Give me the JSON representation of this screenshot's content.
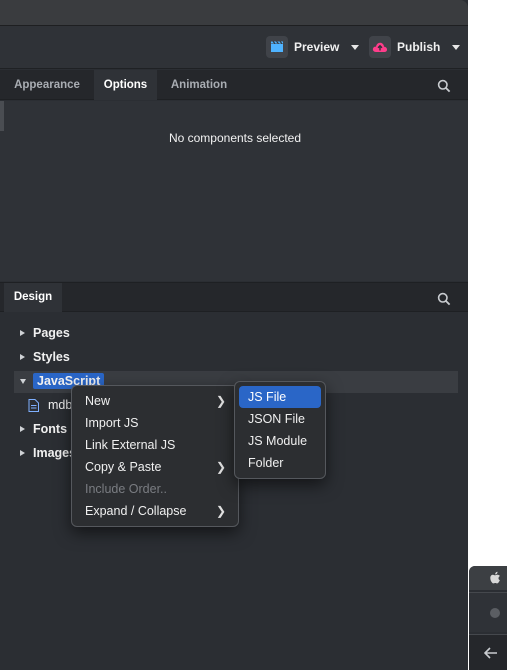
{
  "toolbar": {
    "preview_label": "Preview",
    "publish_label": "Publish"
  },
  "tabs": [
    {
      "label": "Appearance",
      "active": false
    },
    {
      "label": "Options",
      "active": true
    },
    {
      "label": "Animation",
      "active": false
    }
  ],
  "options_panel": {
    "empty_message": "No components selected"
  },
  "design": {
    "header": "Design",
    "tree": [
      {
        "label": "Pages",
        "expanded": false
      },
      {
        "label": "Styles",
        "expanded": false
      },
      {
        "label": "JavaScript",
        "expanded": true,
        "selected": true
      },
      {
        "label": "mdb",
        "type": "file"
      },
      {
        "label": "Fonts",
        "expanded": false
      },
      {
        "label": "Images",
        "expanded": false
      }
    ]
  },
  "context_menu": {
    "items": [
      {
        "label": "New",
        "submenu": true,
        "enabled": true
      },
      {
        "label": "Import JS",
        "submenu": false,
        "enabled": true
      },
      {
        "label": "Link External JS",
        "submenu": false,
        "enabled": true
      },
      {
        "label": "Copy & Paste",
        "submenu": true,
        "enabled": true
      },
      {
        "label": "Include Order..",
        "submenu": false,
        "enabled": false
      },
      {
        "label": "Expand / Collapse",
        "submenu": true,
        "enabled": true
      }
    ]
  },
  "new_submenu": {
    "items": [
      {
        "label": "JS File",
        "highlighted": true
      },
      {
        "label": "JSON File",
        "highlighted": false
      },
      {
        "label": "JS Module",
        "highlighted": false
      },
      {
        "label": "Folder",
        "highlighted": false
      }
    ]
  },
  "colors": {
    "accent": "#2a66c7",
    "preview_icon": "#4fb3ff",
    "publish_icon": "#ff3d8b",
    "panel_bg": "#2f3237"
  },
  "icons": {
    "preview": "clapperboard-icon",
    "publish": "cloud-upload-icon",
    "search": "search-icon",
    "file": "file-icon",
    "apple": "apple-icon",
    "back": "arrow-left-icon"
  }
}
